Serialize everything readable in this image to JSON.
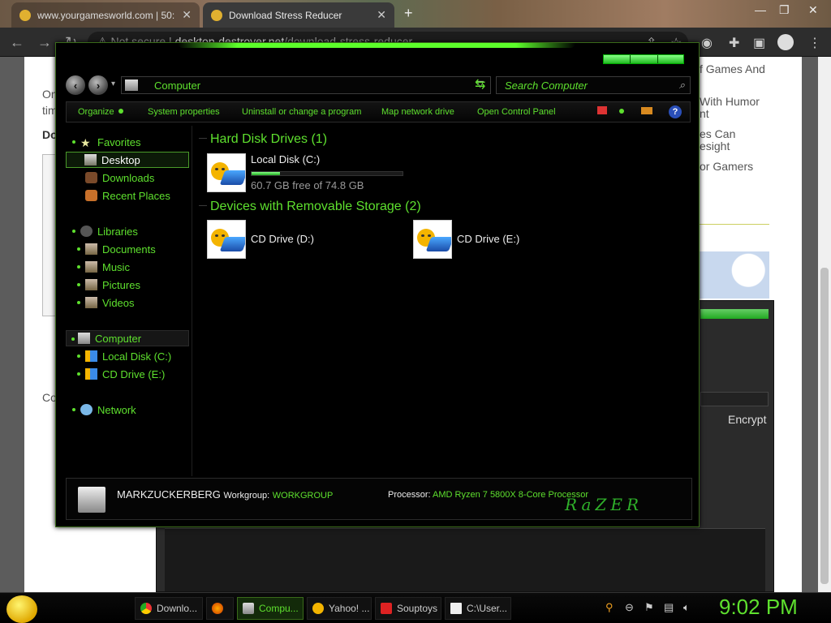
{
  "browser": {
    "tabs": [
      {
        "title": "www.yourgamesworld.com | 50:"
      },
      {
        "title": "Download Stress Reducer"
      }
    ],
    "url_prefix": "Not secure",
    "url_host": "desktop-destroyer.net",
    "url_path": "/download-stress-reducer"
  },
  "webpage": {
    "right_texts": [
      "f Games And",
      "With Humor",
      "nt",
      "es Can",
      "esight",
      "or Gamers"
    ],
    "left_texts": [
      "On",
      "tim",
      "Do",
      "Co"
    ],
    "encrypt": "Encrypt"
  },
  "explorer": {
    "address": "Computer",
    "search_placeholder": "Search Computer",
    "commands": [
      "Organize",
      "System properties",
      "Uninstall or change a program",
      "Map network drive",
      "Open Control Panel"
    ],
    "nav": {
      "favorites": "Favorites",
      "desktop": "Desktop",
      "downloads": "Downloads",
      "recent": "Recent Places",
      "libraries": "Libraries",
      "documents": "Documents",
      "music": "Music",
      "pictures": "Pictures",
      "videos": "Videos",
      "computer": "Computer",
      "local_disk": "Local Disk (C:)",
      "cd_drive": "CD Drive (E:)",
      "network": "Network"
    },
    "groups": {
      "hdd": "Hard Disk Drives (1)",
      "removable": "Devices with Removable Storage (2)"
    },
    "drives": {
      "c_name": "Local Disk (C:)",
      "c_free": "60.7 GB free of 74.8 GB",
      "c_used_fraction": 0.19,
      "d_name": "CD Drive (D:)",
      "e_name": "CD Drive (E:)"
    },
    "details": {
      "computer_name": "MARKZUCKERBERG",
      "workgroup_label": "Workgroup:",
      "workgroup": "WORKGROUP",
      "processor_label": "Processor:",
      "processor": "AMD Ryzen 7 5800X 8-Core Processor"
    },
    "logo": "RaZER"
  },
  "taskbar": {
    "items": [
      "Downlo...",
      "Compu...",
      "Yahoo! ...",
      "Souptoys",
      "C:\\User..."
    ],
    "clock": "9:02 PM"
  },
  "colors": {
    "accent": "#5ee02e"
  }
}
